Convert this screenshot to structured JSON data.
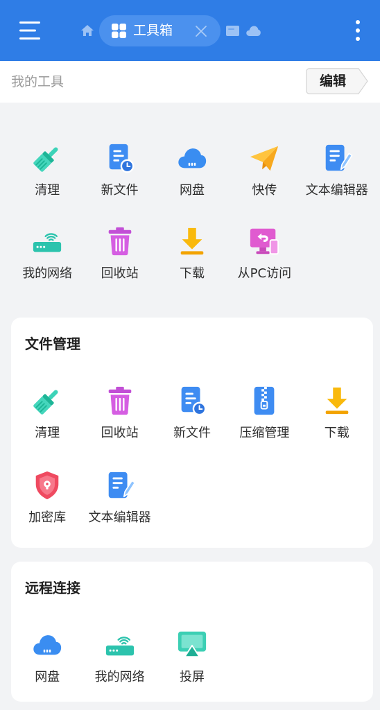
{
  "theme": {
    "header_bg": "#2F7DE6",
    "page_bg": "#F2F3F5",
    "card_bg": "#FFFFFF",
    "tab_pill_bg": "#4B91EE"
  },
  "header": {
    "menu_icon": "menu-icon",
    "home_icon": "home-icon",
    "active_tab": {
      "icon": "grid-icon",
      "label": "工具箱",
      "close_icon": "close-icon"
    },
    "other_tab_icons": [
      "card-icon",
      "cloud-icon"
    ],
    "more_icon": "more-vertical-icon"
  },
  "toolbar": {
    "title": "我的工具",
    "edit_label": "编辑"
  },
  "my_tools": [
    {
      "label": "清理",
      "icon": "broom-icon"
    },
    {
      "label": "新文件",
      "icon": "new-file-icon"
    },
    {
      "label": "网盘",
      "icon": "cloud-drive-icon"
    },
    {
      "label": "快传",
      "icon": "paper-plane-icon"
    },
    {
      "label": "文本编辑器",
      "icon": "text-editor-icon"
    },
    {
      "label": "我的网络",
      "icon": "router-icon"
    },
    {
      "label": "回收站",
      "icon": "trash-icon"
    },
    {
      "label": "下载",
      "icon": "download-icon"
    },
    {
      "label": "从PC访问",
      "icon": "pc-access-icon"
    }
  ],
  "sections": [
    {
      "title": "文件管理",
      "items": [
        {
          "label": "清理",
          "icon": "broom-icon"
        },
        {
          "label": "回收站",
          "icon": "trash-icon"
        },
        {
          "label": "新文件",
          "icon": "new-file-icon"
        },
        {
          "label": "压缩管理",
          "icon": "zip-icon"
        },
        {
          "label": "下载",
          "icon": "download-icon"
        },
        {
          "label": "加密库",
          "icon": "shield-lock-icon"
        },
        {
          "label": "文本编辑器",
          "icon": "text-editor-icon"
        }
      ]
    },
    {
      "title": "远程连接",
      "items": [
        {
          "label": "网盘",
          "icon": "cloud-drive-icon"
        },
        {
          "label": "我的网络",
          "icon": "router-icon"
        },
        {
          "label": "投屏",
          "icon": "screen-cast-icon"
        }
      ]
    }
  ]
}
